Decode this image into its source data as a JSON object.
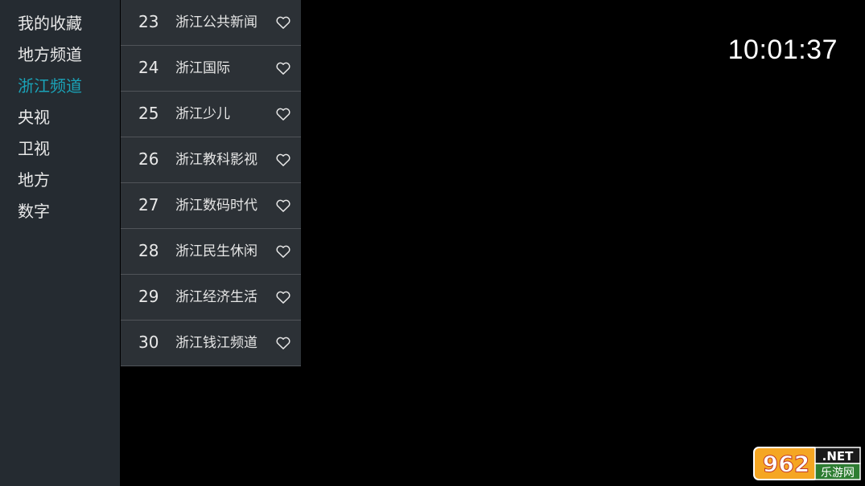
{
  "sidebar": {
    "items": [
      {
        "label": "我的收藏",
        "active": false
      },
      {
        "label": "地方频道",
        "active": false
      },
      {
        "label": "浙江频道",
        "active": true
      },
      {
        "label": "央视",
        "active": false
      },
      {
        "label": "卫视",
        "active": false
      },
      {
        "label": "地方",
        "active": false
      },
      {
        "label": "数字",
        "active": false
      }
    ]
  },
  "channels": [
    {
      "number": "23",
      "name": "浙江公共新闻",
      "icon": "heart-outline-icon"
    },
    {
      "number": "24",
      "name": "浙江国际",
      "icon": "heart-outline-icon"
    },
    {
      "number": "25",
      "name": "浙江少儿",
      "icon": "heart-outline-icon"
    },
    {
      "number": "26",
      "name": "浙江教科影视",
      "icon": "heart-outline-icon"
    },
    {
      "number": "27",
      "name": "浙江数码时代",
      "icon": "heart-outline-icon"
    },
    {
      "number": "28",
      "name": "浙江民生休闲",
      "icon": "heart-outline-icon"
    },
    {
      "number": "29",
      "name": "浙江经济生活",
      "icon": "heart-outline-icon"
    },
    {
      "number": "30",
      "name": "浙江钱江频道",
      "icon": "heart-outline-icon"
    }
  ],
  "clock": {
    "time": "10:01:37"
  },
  "watermark": {
    "brand": "962.NET",
    "subtitle": "乐游网"
  },
  "colors": {
    "accent": "#1aa3b8",
    "sidebar_bg": "#252b31",
    "list_bg": "#2c3136",
    "background": "#000000"
  }
}
